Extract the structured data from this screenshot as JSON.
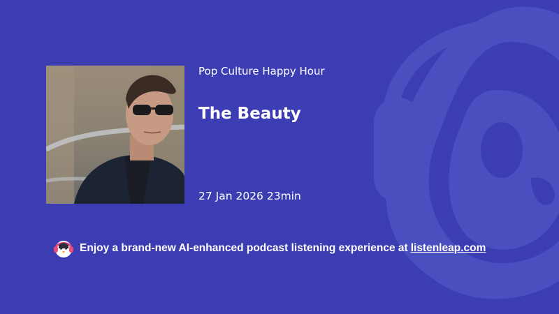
{
  "brand": {
    "background_color": "#3c3db3",
    "mascot_color": "#4a4fc0",
    "logo_icon": "listenleap-penguin-headphones-icon"
  },
  "episode": {
    "cover_image": "episode-cover-image",
    "podcast_name": "Pop Culture Happy Hour",
    "title": "The Beauty",
    "date": "27 Jan 2026",
    "duration": "23min"
  },
  "promo": {
    "text": "Enjoy a brand-new AI-enhanced podcast listening experience at",
    "link_text": "listenleap.com"
  }
}
